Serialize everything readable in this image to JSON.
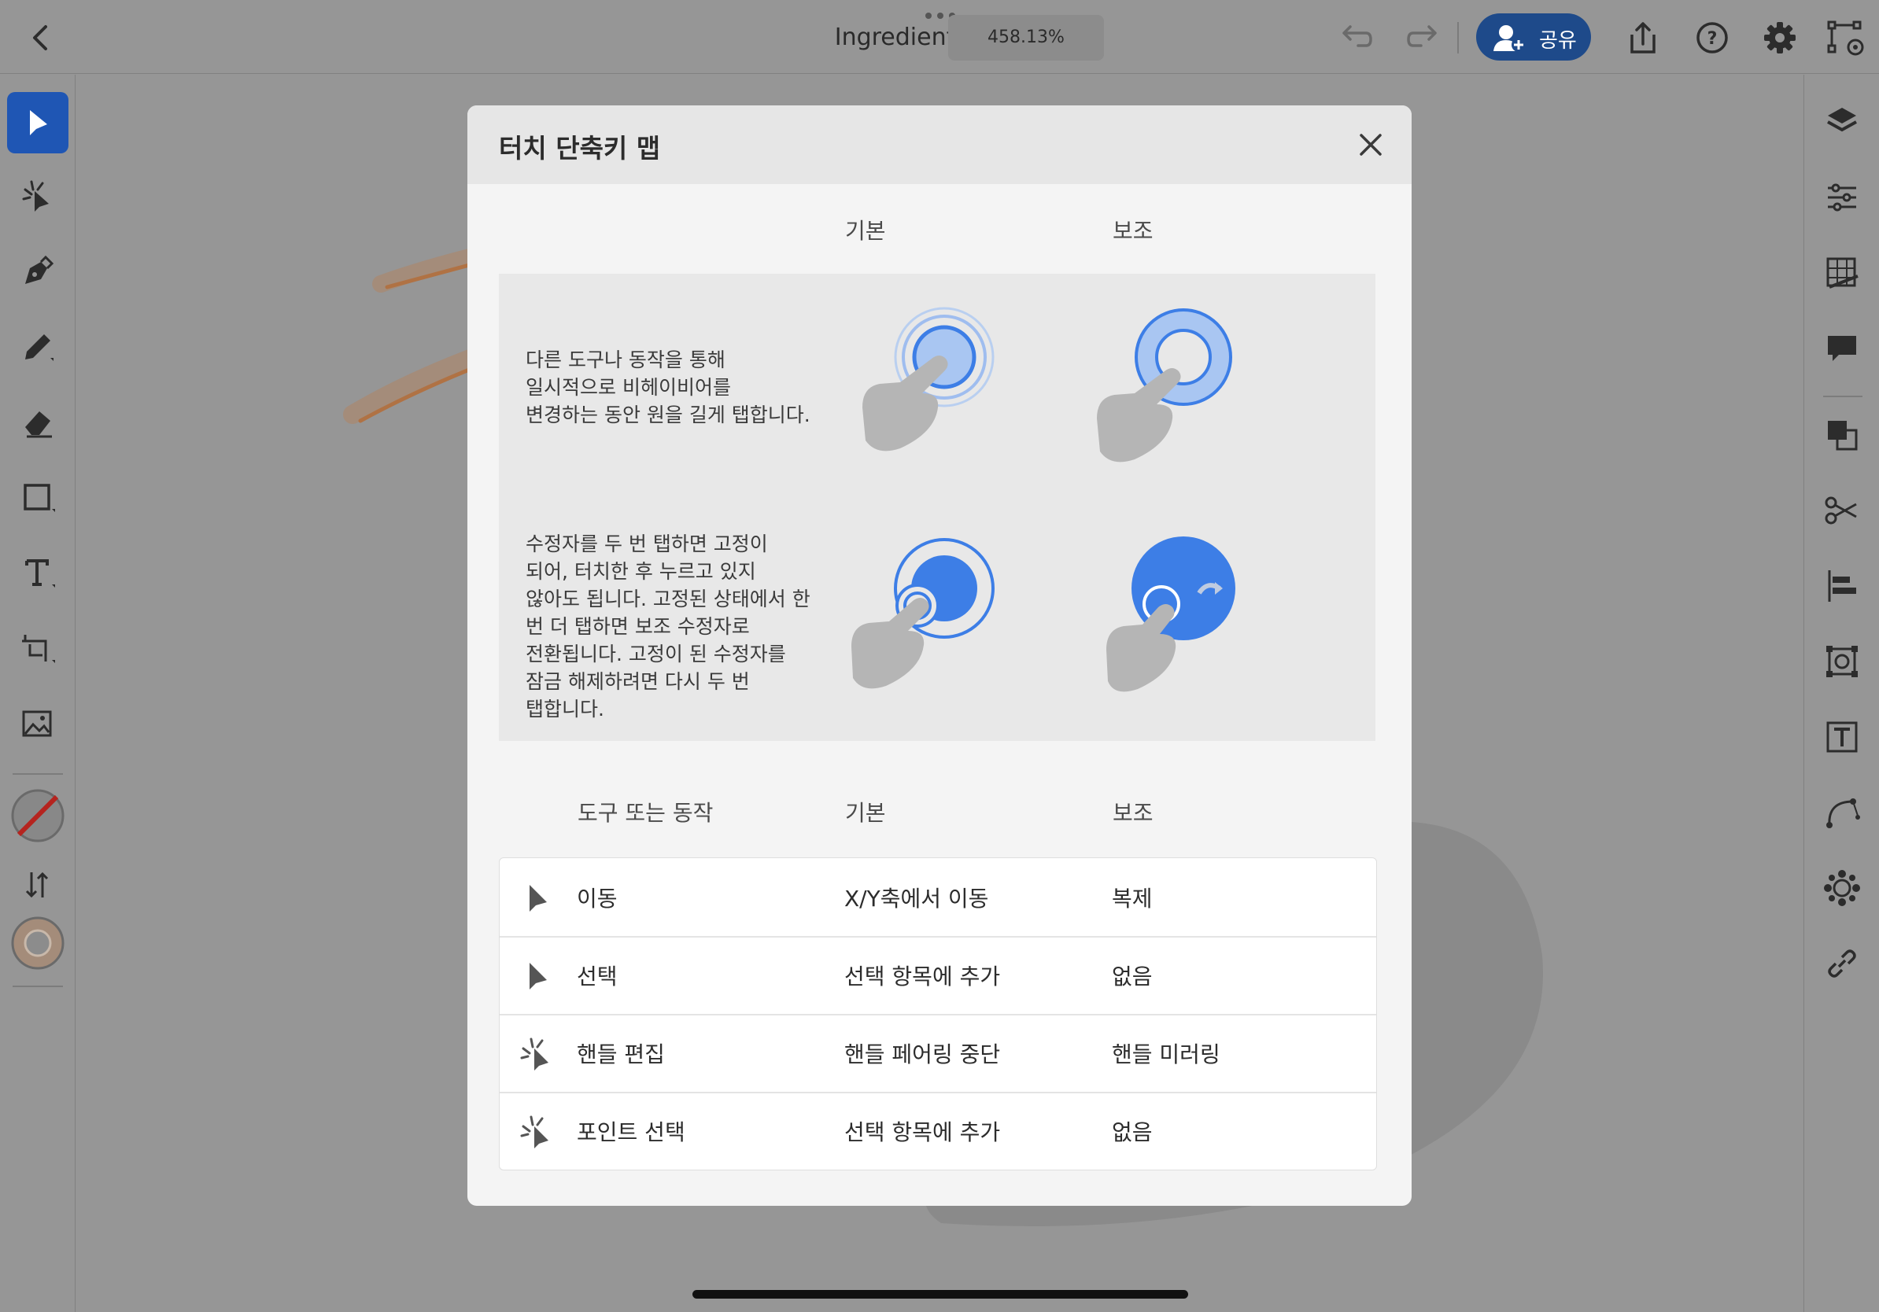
{
  "header": {
    "title": "Ingredients",
    "zoom": "458.13%",
    "share_label": "공유"
  },
  "colors": {
    "accent": "#1f56b4",
    "share_bg": "#1e4a8a",
    "gesture_blue": "#3d7ee6",
    "gesture_light": "#a9c6f2",
    "dim_overlay": "#969696"
  },
  "left_toolbar": {
    "tools": [
      "selection-arrow-icon",
      "direct-select-icon",
      "pen-icon",
      "pencil-icon",
      "eraser-icon",
      "rectangle-icon",
      "text-icon",
      "crop-icon",
      "image-icon",
      "stroke-color-icon",
      "swap-icon",
      "fill-color-icon"
    ]
  },
  "right_toolbar": {
    "icons": [
      "layers-icon",
      "properties-icon",
      "grid-icon",
      "comment-icon",
      "combine-shapes-icon",
      "scissors-icon",
      "align-icon",
      "transform-icon",
      "type-panel-icon",
      "path-icon",
      "repeat-icon",
      "link-icon"
    ]
  },
  "dialog": {
    "title": "터치 단축키 맵",
    "gesture_headers": {
      "primary": "기본",
      "secondary": "보조"
    },
    "gestures": [
      {
        "description": "다른 도구나 동작을 통해\n일시적으로 비헤이비어를\n변경하는 동안 원을 길게 탭합니다."
      },
      {
        "description": "수정자를 두 번 탭하면 고정이\n되어, 터치한 후 누르고 있지\n않아도 됩니다. 고정된 상태에서 한\n번 더 탭하면 보조 수정자로\n전환됩니다. 고정이 된 수정자를\n잠금 해제하려면 다시 두 번\n탭합니다."
      }
    ],
    "table_headers": {
      "tool": "도구 또는 동작",
      "primary": "기본",
      "secondary": "보조"
    },
    "rows": [
      {
        "icon": "move-arrow-icon",
        "tool": "이동",
        "primary": "X/Y축에서 이동",
        "secondary": "복제"
      },
      {
        "icon": "select-arrow-icon",
        "tool": "선택",
        "primary": "선택 항목에 추가",
        "secondary": "없음"
      },
      {
        "icon": "handle-edit-icon",
        "tool": "핸들 편집",
        "primary": "핸들 페어링 중단",
        "secondary": "핸들 미러링"
      },
      {
        "icon": "point-select-icon",
        "tool": "포인트 선택",
        "primary": "선택 항목에 추가",
        "secondary": "없음"
      }
    ]
  }
}
